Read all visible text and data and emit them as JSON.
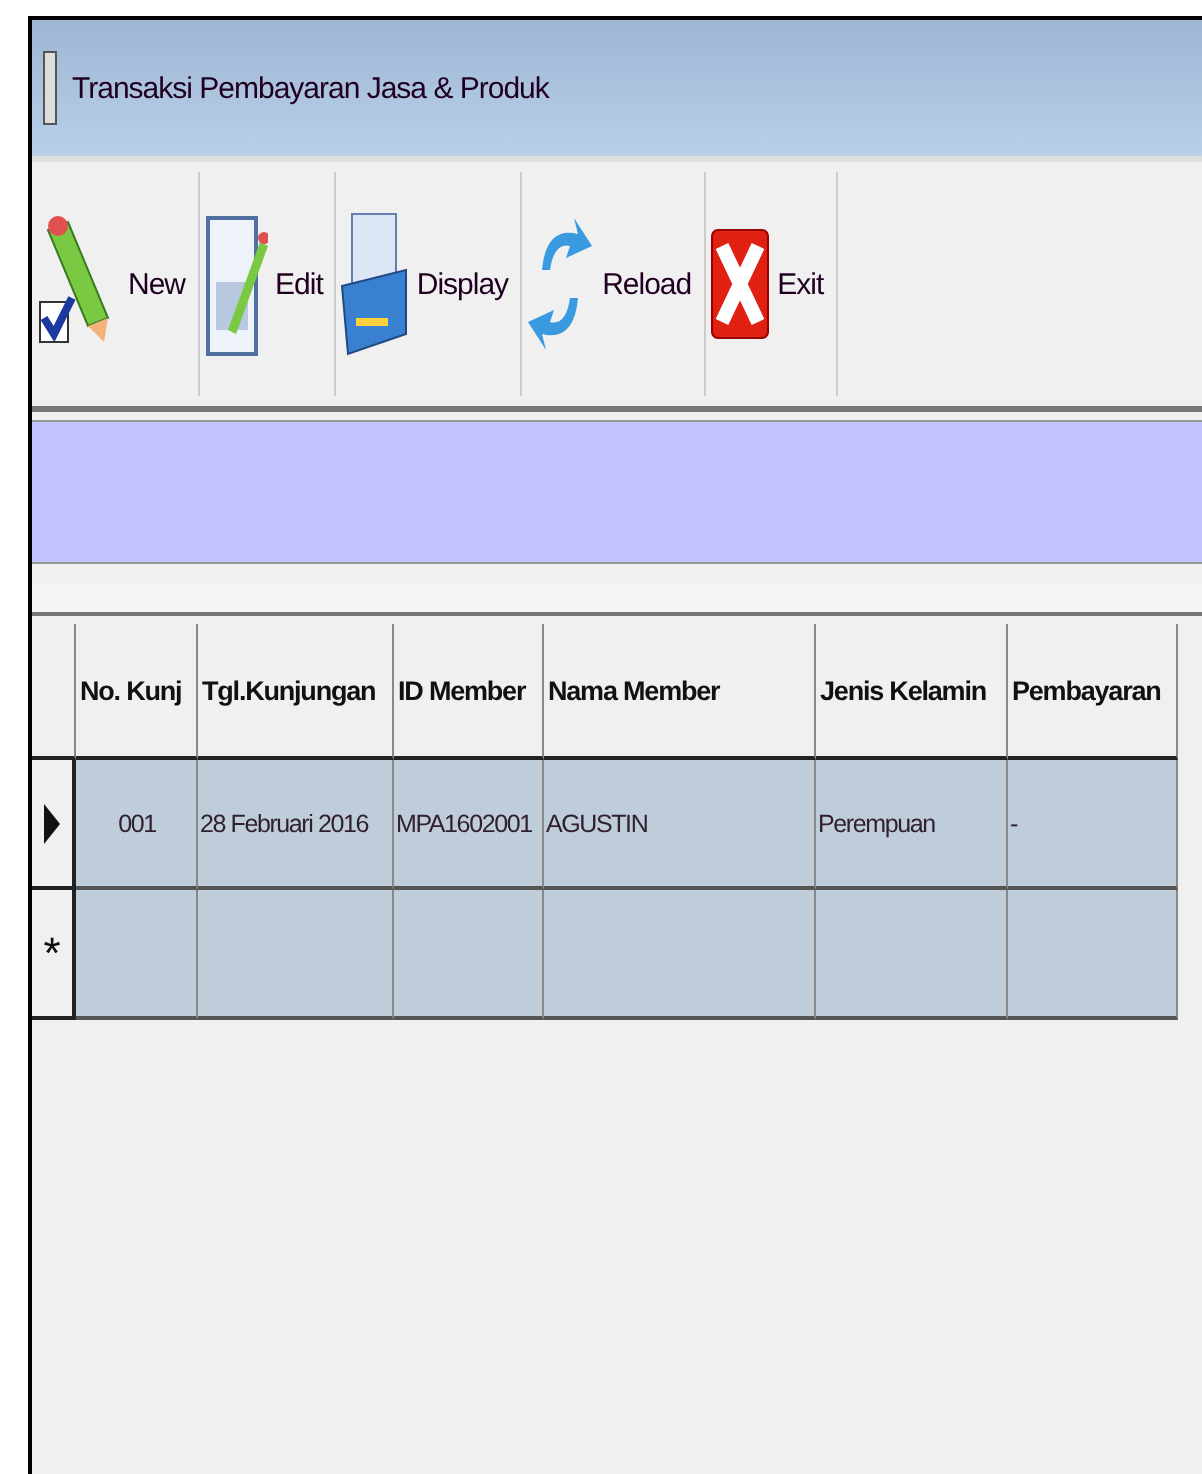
{
  "window": {
    "title": "Transaksi Pembayaran Jasa & Produk"
  },
  "toolbar": [
    {
      "kind": "new",
      "label": "New"
    },
    {
      "kind": "edit",
      "label": "Edit"
    },
    {
      "kind": "display",
      "label": "Display"
    },
    {
      "kind": "reload",
      "label": "Reload"
    },
    {
      "kind": "exit",
      "label": "Exit"
    }
  ],
  "table": {
    "columns": [
      "No. Kunj",
      "Tgl.Kunjungan",
      "ID Member",
      "Nama Member",
      "Jenis Kelamin",
      "Pembayaran"
    ],
    "rows": [
      {
        "selected": true,
        "cells": [
          "001",
          "28 Februari 2016",
          "MPA1602001",
          "AGUSTIN",
          "Perempuan",
          "-"
        ]
      }
    ],
    "new_row_marker": "*"
  }
}
